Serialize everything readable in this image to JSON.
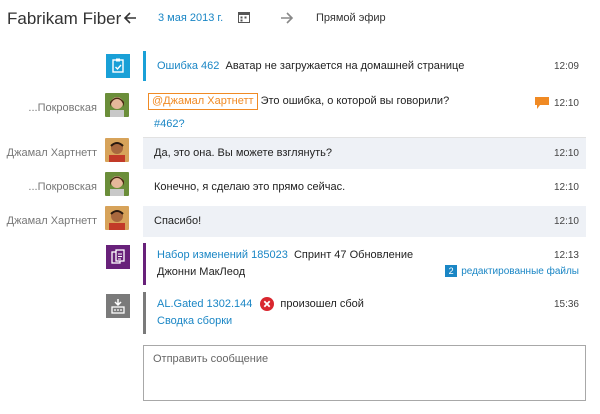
{
  "header": {
    "title": "Fabrikam Fiber",
    "date": "3 мая 2013 г.",
    "live": "Прямой эфир"
  },
  "rows": [
    {
      "type": "workitem",
      "link": "Ошибка 462",
      "text": "Аватар не загружается на домашней странице",
      "time": "12:09",
      "color": "#19a0d7"
    },
    {
      "type": "message",
      "sender": "...Покровская",
      "mention": "@Джамал Хартнетт",
      "text": "Это ошибка, о которой вы говорили?",
      "link": "#462?",
      "time": "12:10"
    },
    {
      "type": "message",
      "sender": "Джамал Хартнетт",
      "text": "Да, это она. Вы можете взглянуть?",
      "time": "12:10"
    },
    {
      "type": "message",
      "sender": "...Покровская",
      "text": "Конечно, я сделаю это прямо сейчас.",
      "time": "12:10"
    },
    {
      "type": "message",
      "sender": "Джамал Хартнетт",
      "text": "Спасибо!",
      "time": "12:10"
    },
    {
      "type": "changeset",
      "link": "Набор изменений 185023",
      "text": "Спринт 47 Обновление",
      "author": "Джонни МакЛеод",
      "time": "12:13",
      "badge": "2",
      "files": "редактированные файлы",
      "color": "#68217a"
    },
    {
      "type": "build",
      "link": "AL.Gated 1302.144",
      "status": "произошел сбой",
      "summary": "Сводка сборки",
      "time": "15:36",
      "color": "#7a7a7a"
    }
  ],
  "composer": {
    "placeholder": "Отправить сообщение"
  },
  "colors": {
    "accent": "#1a86c5",
    "mention": "#f08a24",
    "error": "#d9262e"
  }
}
